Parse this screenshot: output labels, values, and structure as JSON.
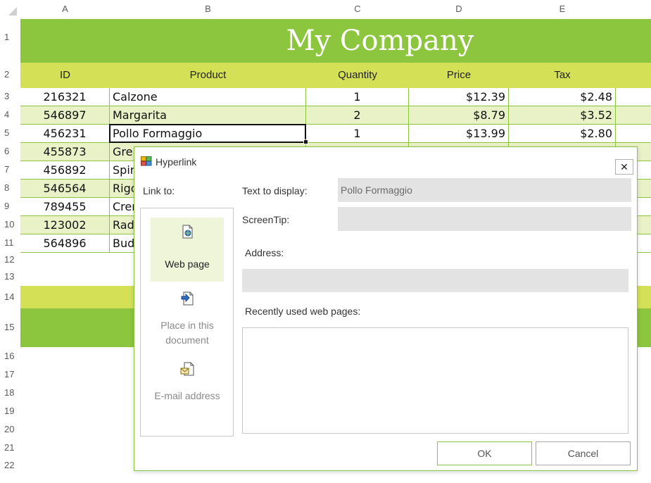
{
  "sheet": {
    "columns": [
      "A",
      "B",
      "C",
      "D",
      "E"
    ],
    "rows": [
      "1",
      "2",
      "3",
      "4",
      "5",
      "6",
      "7",
      "8",
      "9",
      "10",
      "11",
      "12",
      "13",
      "14",
      "15",
      "16",
      "17",
      "18",
      "19",
      "20",
      "21",
      "22"
    ],
    "title": "My Company",
    "headers": {
      "id": "ID",
      "product": "Product",
      "quantity": "Quantity",
      "price": "Price",
      "tax": "Tax"
    },
    "data": [
      {
        "id": "216321",
        "product": "Calzone",
        "quantity": "1",
        "price": "$12.39",
        "tax": "$2.48"
      },
      {
        "id": "546897",
        "product": "Margarita",
        "quantity": "2",
        "price": "$8.79",
        "tax": "$3.52"
      },
      {
        "id": "456231",
        "product": "Pollo Formaggio",
        "quantity": "1",
        "price": "$13.99",
        "tax": "$2.80"
      },
      {
        "id": "455873",
        "product": "Gre",
        "quantity": "",
        "price": "",
        "tax": ""
      },
      {
        "id": "456892",
        "product": "Spir",
        "quantity": "",
        "price": "",
        "tax": ""
      },
      {
        "id": "546564",
        "product": "Rigo",
        "quantity": "",
        "price": "",
        "tax": ""
      },
      {
        "id": "789455",
        "product": "Crer",
        "quantity": "",
        "price": "",
        "tax": ""
      },
      {
        "id": "123002",
        "product": "Rad",
        "quantity": "",
        "price": "",
        "tax": ""
      },
      {
        "id": "564896",
        "product": "Bud",
        "quantity": "",
        "price": "",
        "tax": ""
      }
    ],
    "colors": {
      "title_band": "#8cc63f",
      "header_band": "#d4e157",
      "alt_row": "#e9f1c7",
      "grid_line": "#8cc63f"
    }
  },
  "dialog": {
    "title": "Hyperlink",
    "close_glyph": "✕",
    "link_to_label": "Link to:",
    "text_to_display_label": "Text to display:",
    "text_to_display_value": "Pollo Formaggio",
    "screentip_label": "ScreenTip:",
    "screentip_value": "",
    "address_label": "Address:",
    "address_value": "",
    "recent_label": "Recently used web pages:",
    "link_options": [
      {
        "label": "Web page",
        "icon": "web-page-icon"
      },
      {
        "label": "Place in this document",
        "icon": "place-in-document-icon"
      },
      {
        "label": "E-mail address",
        "icon": "email-address-icon"
      }
    ],
    "ok_label": "OK",
    "cancel_label": "Cancel"
  }
}
